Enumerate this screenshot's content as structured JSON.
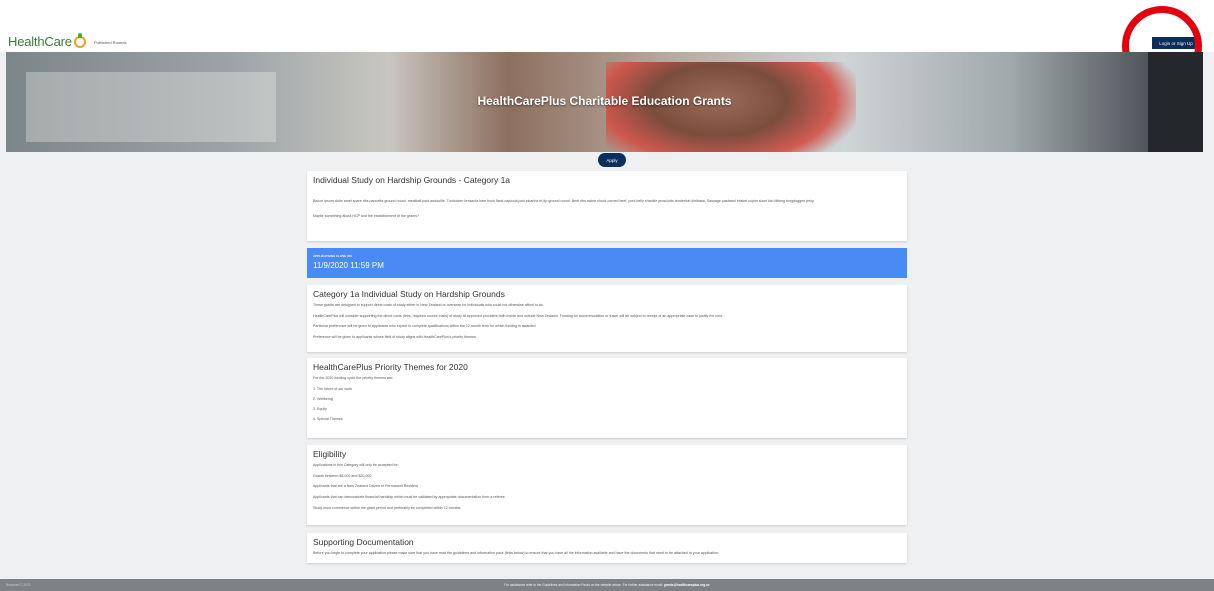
{
  "header": {
    "logo_text": "HealthCare",
    "nav_published": "Published Rounds",
    "login_label": "Login or Sign Up"
  },
  "hero": {
    "title": "HealthCarePlus Charitable Education Grants"
  },
  "apply_label": "Apply",
  "intro": {
    "title": "Individual Study on Hardship Grounds - Category 1a",
    "body": "Bacon ipsum dolor amet spare ribs pancetta ground round, meatball pork andouille. Turducken bresaola ham hock flank capicola jowl picanha tri-tip ground round. Beef ribs swine chuck corned beef, pork belly shankle prosciutto tenderloin kielbasa. Sausage pastrami brisket cupim short loin biltong burgdoggen jerky.",
    "note": "Maybe something about HCP and the establishment of the grants?"
  },
  "closing": {
    "label": "APPLICATIONS CLOSE ON",
    "datetime": "11/9/2020 11:59 PM"
  },
  "category": {
    "title": "Category 1a Individual Study on Hardship Grounds",
    "p1": "These grants are designed to support direct costs of study either in New Zealand or overseas for individuals who could not otherwise afford to do.",
    "p2": "HealthCarePlus will consider supporting the direct costs (fees, required course costs) of study at approved providers both inside and outside New Zealand. Funding for accommodation or travel will be subject to receipt of an appropriate case to justify the cost.",
    "p3": "Particular preference will be given to applicants who expect to complete qualifications within the 12 month term for which funding is awarded.",
    "p4": "Preference will be given to applicants whose field of study aligns with HealthCarePlus's priority themes."
  },
  "priority": {
    "title": "HealthCarePlus Priority Themes for 2020",
    "intro": "For the 2020 funding cycle the priority themes are:",
    "items": [
      "1.   The future of our work",
      "2.   Wellbeing",
      "3.   Equity",
      "4.   Special Themes"
    ]
  },
  "eligibility": {
    "title": "Eligibility",
    "lines": [
      "Applications in this Category will only be accepted for:",
      "Grants between $5,000 and $20,000",
      "Applicants that are a New Zealand Citizen or Permanent Resident",
      "Applicants that can demonstrate financial hardship which must be validated by appropriate documentation from a referee",
      "Study must commence within the grant period and preferably be completed within 12 months"
    ]
  },
  "supporting": {
    "title": "Supporting Documentation",
    "body": "Before you begin to complete your application please make sure that you have read the guidelines and information pack (links below) to ensure that you have all the information available and have the documents that need to be attached to your application."
  },
  "footer": {
    "copyright": "Resolved © 2020",
    "note": "For assistance refer to the Guidelines and Information Packs on the website above. For further assistance email:",
    "email": "grants@healthcareplus.org.nz"
  }
}
